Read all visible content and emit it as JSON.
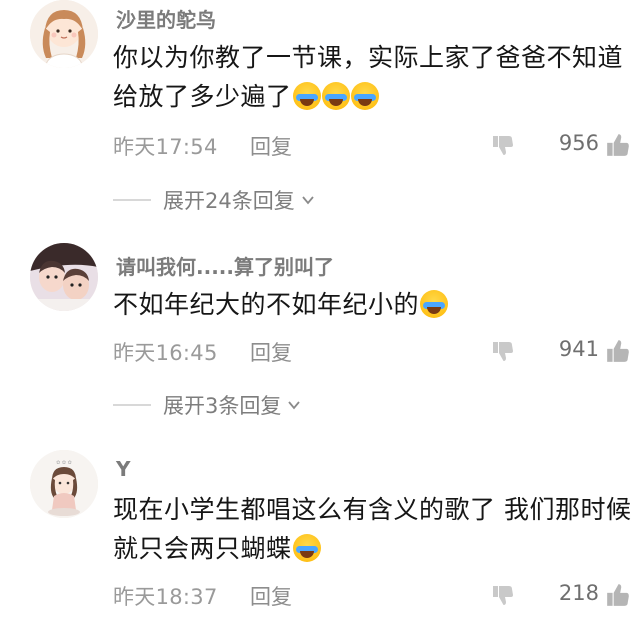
{
  "comments": [
    {
      "username": "沙里的鸵鸟",
      "text": "你以为你教了一节课，实际上家了爸爸不知道给放了多少遍了",
      "emoji_count": 3,
      "time": "昨天17:54",
      "reply_label": "回复",
      "likes": "956",
      "expand_label": "展开24条回复"
    },
    {
      "username": "请叫我何.....算了别叫了",
      "text": "不如年纪大的不如年纪小的",
      "emoji_count": 1,
      "time": "昨天16:45",
      "reply_label": "回复",
      "likes": "941",
      "expand_label": "展开3条回复"
    },
    {
      "username": "Y",
      "text": "现在小学生都唱这么有含义的歌了 我们那时候就只会两只蝴蝶",
      "emoji_count": 1,
      "time": "昨天18:37",
      "reply_label": "回复",
      "likes": "218"
    }
  ],
  "icons": {
    "dislike": "thumbs-down-icon",
    "like": "thumbs-up-icon",
    "expand": "chevron-down-icon",
    "emoji": "crying-laughing-emoji"
  }
}
